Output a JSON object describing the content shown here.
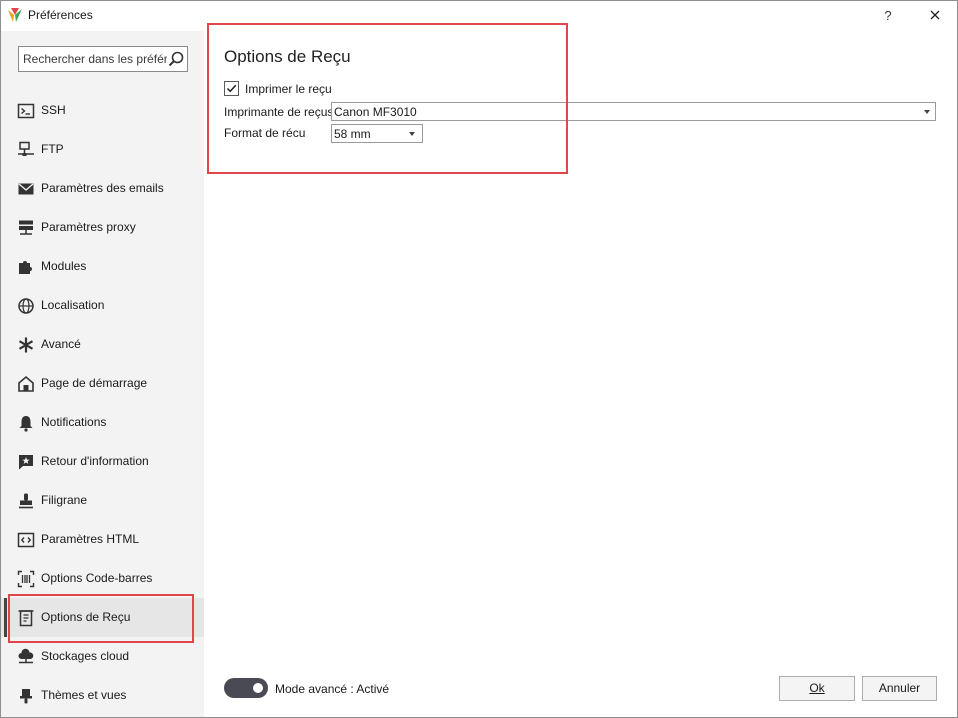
{
  "window": {
    "title": "Préférences",
    "help_label": "?"
  },
  "sidebar": {
    "search_placeholder": "Rechercher dans les préférences",
    "items": [
      {
        "label": "SSH",
        "icon": "terminal-icon"
      },
      {
        "label": "FTP",
        "icon": "network-icon"
      },
      {
        "label": "Paramètres des emails",
        "icon": "email-icon"
      },
      {
        "label": "Paramètres proxy",
        "icon": "proxy-server-icon"
      },
      {
        "label": "Modules",
        "icon": "puzzle-icon"
      },
      {
        "label": "Localisation",
        "icon": "globe-icon"
      },
      {
        "label": "Avancé",
        "icon": "asterisk-icon"
      },
      {
        "label": "Page de démarrage",
        "icon": "home-icon"
      },
      {
        "label": "Notifications",
        "icon": "bell-icon"
      },
      {
        "label": "Retour d'information",
        "icon": "feedback-star-icon"
      },
      {
        "label": "Filigrane",
        "icon": "stamp-icon"
      },
      {
        "label": "Paramètres HTML",
        "icon": "code-icon"
      },
      {
        "label": "Options Code-barres",
        "icon": "barcode-icon"
      },
      {
        "label": "Options de Reçu",
        "icon": "receipt-icon",
        "selected": true
      },
      {
        "label": "Stockages cloud",
        "icon": "cloud-icon"
      },
      {
        "label": "Thèmes et vues",
        "icon": "themes-icon"
      }
    ]
  },
  "main": {
    "title": "Options de Reçu",
    "print_receipt_label": "Imprimer le reçu",
    "print_receipt_checked": true,
    "printer_label": "Imprimante de reçus",
    "printer_value": "Canon MF3010",
    "format_label": "Format de récu",
    "format_value": "58 mm"
  },
  "footer": {
    "advanced_mode_label": "Mode avancé : Activé",
    "advanced_mode_on": true,
    "ok_label": "Ok",
    "cancel_label": "Annuler"
  },
  "colors": {
    "highlight": "#e0464a",
    "sidebar_bg": "#f3f3f3",
    "toggle_on": "#4a4a55"
  }
}
